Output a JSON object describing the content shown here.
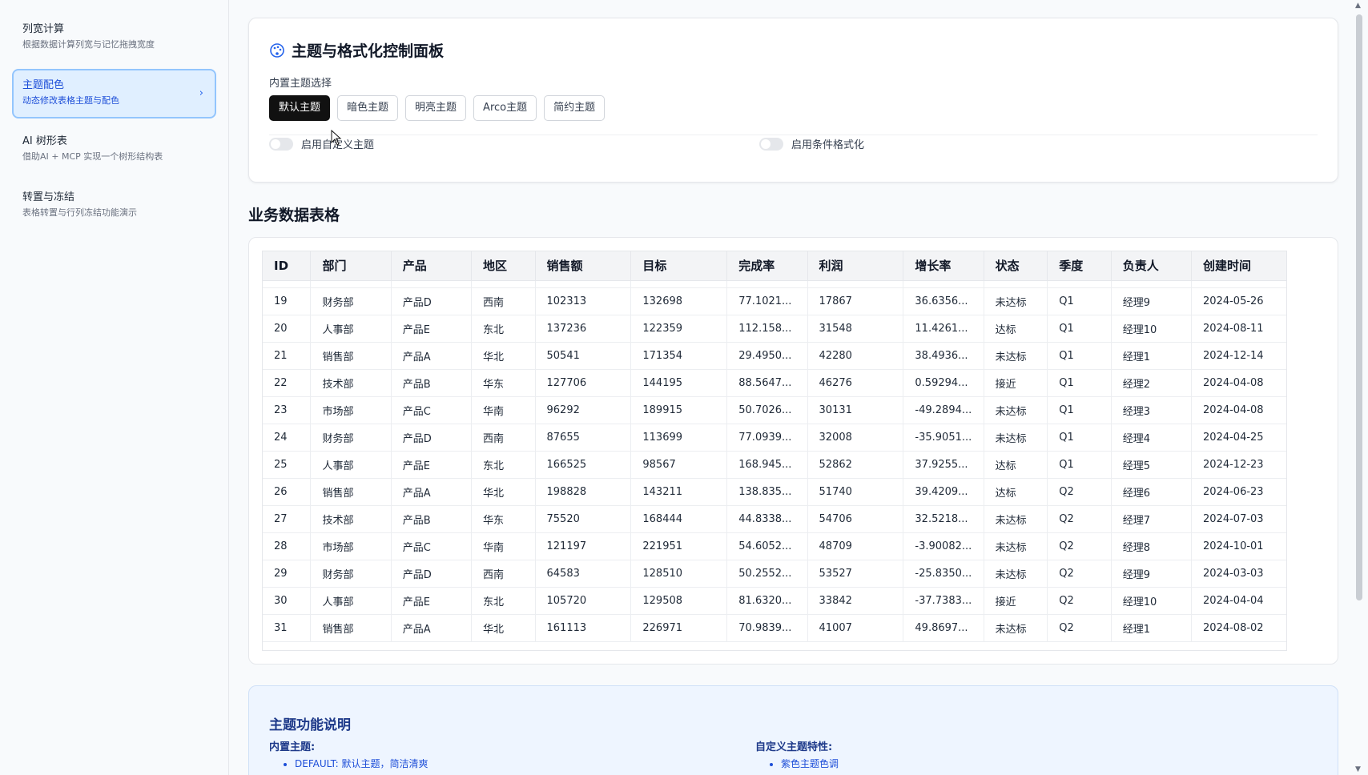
{
  "sidebar": {
    "items": [
      {
        "title": "列宽计算",
        "desc": "根据数据计算列宽与记忆拖拽宽度"
      },
      {
        "title": "主题配色",
        "desc": "动态修改表格主题与配色"
      },
      {
        "title": "AI 树形表",
        "desc": "借助AI + MCP 实现一个树形结构表"
      },
      {
        "title": "转置与冻结",
        "desc": "表格转置与行列冻结功能演示"
      }
    ]
  },
  "panel": {
    "title": "主题与格式化控制面板",
    "theme_label": "内置主题选择",
    "themes": [
      "默认主题",
      "暗色主题",
      "明亮主题",
      "Arco主题",
      "简约主题"
    ],
    "toggle_custom": "启用自定义主题",
    "toggle_conditional": "启用条件格式化"
  },
  "table_section_title": "业务数据表格",
  "table": {
    "columns": [
      "ID",
      "部门",
      "产品",
      "地区",
      "销售额",
      "目标",
      "完成率",
      "利润",
      "增长率",
      "状态",
      "季度",
      "负责人",
      "创建时间"
    ],
    "rows": [
      [
        "19",
        "财务部",
        "产品D",
        "西南",
        "102313",
        "132698",
        "77.1021...",
        "17867",
        "36.6356...",
        "未达标",
        "Q1",
        "经理9",
        "2024-05-26"
      ],
      [
        "20",
        "人事部",
        "产品E",
        "东北",
        "137236",
        "122359",
        "112.158...",
        "31548",
        "11.4261...",
        "达标",
        "Q1",
        "经理10",
        "2024-08-11"
      ],
      [
        "21",
        "销售部",
        "产品A",
        "华北",
        "50541",
        "171354",
        "29.4950...",
        "42280",
        "38.4936...",
        "未达标",
        "Q1",
        "经理1",
        "2024-12-14"
      ],
      [
        "22",
        "技术部",
        "产品B",
        "华东",
        "127706",
        "144195",
        "88.5647...",
        "46276",
        "0.59294...",
        "接近",
        "Q1",
        "经理2",
        "2024-04-08"
      ],
      [
        "23",
        "市场部",
        "产品C",
        "华南",
        "96292",
        "189915",
        "50.7026...",
        "30131",
        "-49.2894...",
        "未达标",
        "Q1",
        "经理3",
        "2024-04-08"
      ],
      [
        "24",
        "财务部",
        "产品D",
        "西南",
        "87655",
        "113699",
        "77.0939...",
        "32008",
        "-35.9051...",
        "未达标",
        "Q1",
        "经理4",
        "2024-04-25"
      ],
      [
        "25",
        "人事部",
        "产品E",
        "东北",
        "166525",
        "98567",
        "168.945...",
        "52862",
        "37.9255...",
        "达标",
        "Q1",
        "经理5",
        "2024-12-23"
      ],
      [
        "26",
        "销售部",
        "产品A",
        "华北",
        "198828",
        "143211",
        "138.835...",
        "51740",
        "39.4209...",
        "达标",
        "Q2",
        "经理6",
        "2024-06-23"
      ],
      [
        "27",
        "技术部",
        "产品B",
        "华东",
        "75520",
        "168444",
        "44.8338...",
        "54706",
        "32.5218...",
        "未达标",
        "Q2",
        "经理7",
        "2024-07-03"
      ],
      [
        "28",
        "市场部",
        "产品C",
        "华南",
        "121197",
        "221951",
        "54.6052...",
        "48709",
        "-3.90082...",
        "未达标",
        "Q2",
        "经理8",
        "2024-10-01"
      ],
      [
        "29",
        "财务部",
        "产品D",
        "西南",
        "64583",
        "128510",
        "50.2552...",
        "53527",
        "-25.8350...",
        "未达标",
        "Q2",
        "经理9",
        "2024-03-03"
      ],
      [
        "30",
        "人事部",
        "产品E",
        "东北",
        "105720",
        "129508",
        "81.6320...",
        "33842",
        "-37.7383...",
        "接近",
        "Q2",
        "经理10",
        "2024-04-04"
      ],
      [
        "31",
        "销售部",
        "产品A",
        "华北",
        "161113",
        "226971",
        "70.9839...",
        "41007",
        "49.8697...",
        "未达标",
        "Q2",
        "经理1",
        "2024-08-02"
      ]
    ]
  },
  "description": {
    "title": "主题功能说明",
    "left_heading": "内置主题:",
    "left_items": [
      "DEFAULT: 默认主题，简洁清爽"
    ],
    "right_heading": "自定义主题特性:",
    "right_items": [
      "紫色主题色调"
    ]
  },
  "colors": {
    "accent": "#2563eb",
    "active_button": "#111111",
    "desc_bg": "#eef5ff"
  }
}
